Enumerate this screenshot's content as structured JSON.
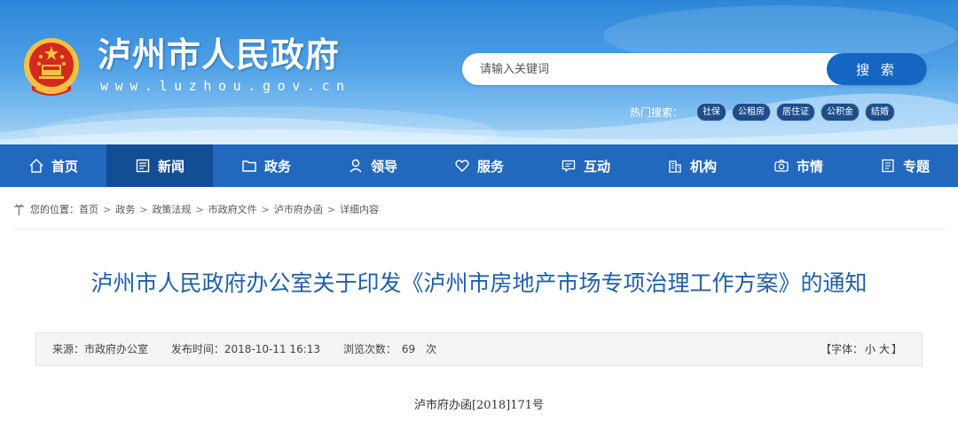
{
  "header": {
    "site_title": "泸州市人民政府",
    "site_url": "www.luzhou.gov.cn"
  },
  "search": {
    "placeholder": "请输入关键词",
    "button_label": "搜 索",
    "hot_label": "热门搜索：",
    "hot_tags": [
      "社保",
      "公租房",
      "居住证",
      "公积金",
      "结婚"
    ]
  },
  "nav": {
    "items": [
      {
        "label": "首页",
        "icon": "home-icon"
      },
      {
        "label": "新闻",
        "icon": "newspaper-icon",
        "active": true
      },
      {
        "label": "政务",
        "icon": "folder-icon"
      },
      {
        "label": "领导",
        "icon": "person-icon"
      },
      {
        "label": "服务",
        "icon": "heart-icon"
      },
      {
        "label": "互动",
        "icon": "chat-icon"
      },
      {
        "label": "机构",
        "icon": "building-icon"
      },
      {
        "label": "市情",
        "icon": "camera-icon"
      },
      {
        "label": "专题",
        "icon": "document-icon"
      }
    ]
  },
  "breadcrumb": {
    "prefix": "您的位置：",
    "items": [
      "首页",
      "政务",
      "政策法规",
      "市政府文件",
      "泸市府办函",
      "详细内容"
    ],
    "separator": ">"
  },
  "article": {
    "title": "泸州市人民政府办公室关于印发《泸州市房地产市场专项治理工作方案》的通知",
    "source_label": "来源：",
    "source": "市政府办公室",
    "publish_label": "发布时间：",
    "publish_time": "2018-10-11 16:13",
    "views_label": "浏览次数：",
    "views": "69",
    "views_unit": "次",
    "font_prefix": "【字体：",
    "font_small": "小",
    "font_large": "大",
    "font_suffix": "】",
    "doc_number": "泸市府办函[2018]171号"
  },
  "colors": {
    "nav_bg": "#2269bd",
    "nav_active": "#134e95",
    "title_blue": "#1f5fa8",
    "search_button": "#1466c2",
    "emblem_red": "#d42a1e",
    "emblem_gold": "#f3c243"
  }
}
